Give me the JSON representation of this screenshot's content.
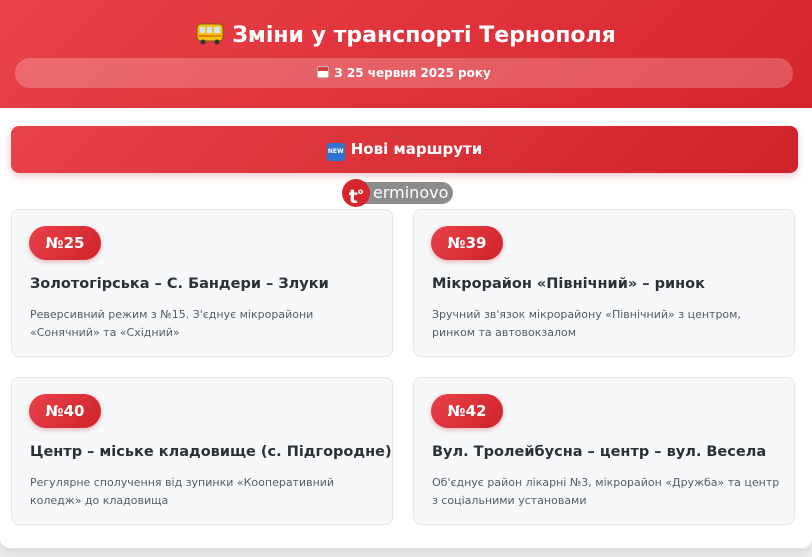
{
  "header": {
    "title": "Зміни у транспорті Тернополя",
    "date": "З 25 червня 2025 року",
    "title_icon": "bus-icon",
    "date_icon": "calendar-icon"
  },
  "section": {
    "label": "Нові маршрути",
    "icon": "new-icon"
  },
  "watermark": {
    "letter": "t",
    "text": "erminovo"
  },
  "routes": [
    {
      "number": "№25",
      "name": "Золотогірська – С. Бандери – Злуки",
      "description": "Реверсивний режим з №15. З'єднує мікрорайони «Сонячний» та «Східний»"
    },
    {
      "number": "№39",
      "name": "Мікрорайон «Північний» – ринок",
      "description": "Зручний зв'язок мікрорайону «Північний» з центром, ринком та автовокзалом"
    },
    {
      "number": "№40",
      "name": "Центр – міське кладовище (с. Підгородне)",
      "description": "Регулярне сполучення від зупинки «Кооперативний коледж» до кладовища"
    },
    {
      "number": "№42",
      "name": "Вул. Тролейбусна – центр – вул. Весела",
      "description": "Об'єднує район лікарні №3, мікрорайон «Дружба» та центр з соціальними установами"
    }
  ],
  "colors": {
    "accent": "#dc2f37",
    "card_bg": "#f7f8fa",
    "text": "#2b2f36"
  }
}
